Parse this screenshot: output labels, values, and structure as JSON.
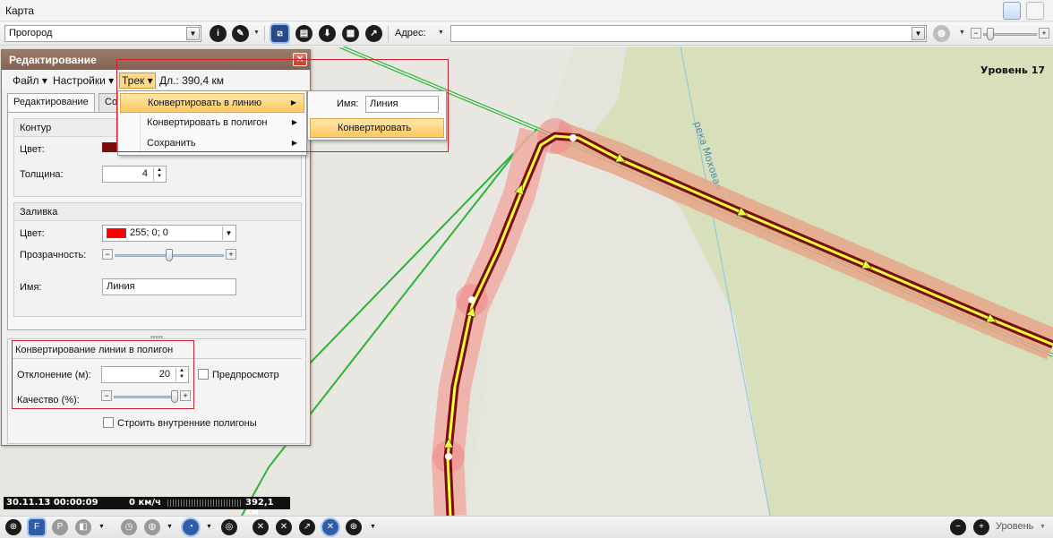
{
  "window": {
    "title": "Карта"
  },
  "toolbar": {
    "map_source": "Прогород",
    "address_label": "Адрес:",
    "address_value": ""
  },
  "map": {
    "level_label": "Уровень 17",
    "river_label": "река Моховая",
    "colors": {
      "land": "#e9e8e2",
      "field": "#d8e1bd",
      "track": "#7a0d0d",
      "highlight": "#ffff33",
      "buffer": "#f3a199"
    }
  },
  "status": {
    "datetime": "30.11.13   00:00:09",
    "speed": "0 км/ч",
    "distance": "392,1 км"
  },
  "edit_panel": {
    "title": "Редактирование",
    "menu": {
      "file": "Файл",
      "settings": "Настройки",
      "track": "Трек",
      "length": "Дл.: 390,4 км"
    },
    "tabs": [
      "Редактирование",
      "Со"
    ],
    "contour": {
      "heading": "Контур",
      "color_label": "Цвет:",
      "thickness_label": "Толщина:",
      "thickness_value": "4"
    },
    "fill": {
      "heading": "Заливка",
      "color_label": "Цвет:",
      "color_value": "255; 0; 0",
      "opacity_label": "Прозрачность:",
      "opacity_level": 0.5
    },
    "name_label": "Имя:",
    "name_value": "Линия",
    "convert": {
      "heading": "Конвертирование линии в полигон",
      "deviation_label": "Отклонение (м):",
      "deviation_value": "20",
      "preview_label": "Предпросмотр",
      "quality_label": "Качество (%):",
      "quality_level": 1.0,
      "inner_label": "Строить внутренние полигоны"
    }
  },
  "track_menu": {
    "items": [
      "Конвертировать в линию",
      "Конвертировать в полигон",
      "Сохранить"
    ]
  },
  "submenu": {
    "name_label": "Имя:",
    "name_value": "Линия",
    "convert_button": "Конвертировать"
  },
  "bottombar": {
    "level_label": "Уровень"
  }
}
